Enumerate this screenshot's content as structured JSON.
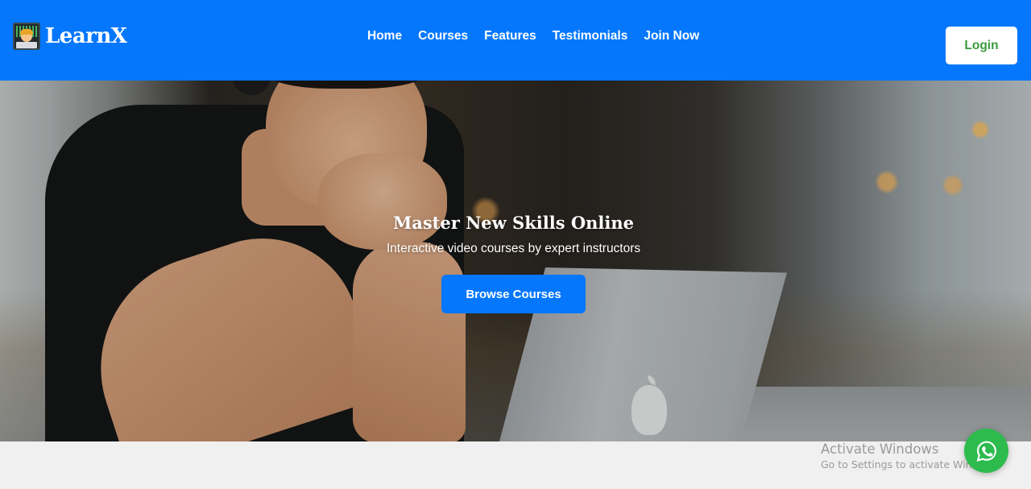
{
  "brand": {
    "name": "LearnX",
    "logo_icon": "developer-avatar-icon"
  },
  "nav": {
    "links": [
      {
        "label": "Home"
      },
      {
        "label": "Courses"
      },
      {
        "label": "Features"
      },
      {
        "label": "Testimonials"
      },
      {
        "label": "Join Now"
      }
    ],
    "login_label": "Login"
  },
  "hero": {
    "title": "Master New Skills Online",
    "subtitle": "Interactive video courses by expert instructors",
    "cta_label": "Browse Courses",
    "image": "person-at-laptop-photo"
  },
  "os_watermark": {
    "title": "Activate Windows",
    "subtitle": "Go to Settings to activate Windows."
  },
  "floating_button": {
    "icon": "whatsapp-icon"
  },
  "colors": {
    "primary": "#0477fd",
    "login_text": "#3a9a3e",
    "whatsapp": "#2dbb4e",
    "page_bg": "#f0f0f0"
  }
}
